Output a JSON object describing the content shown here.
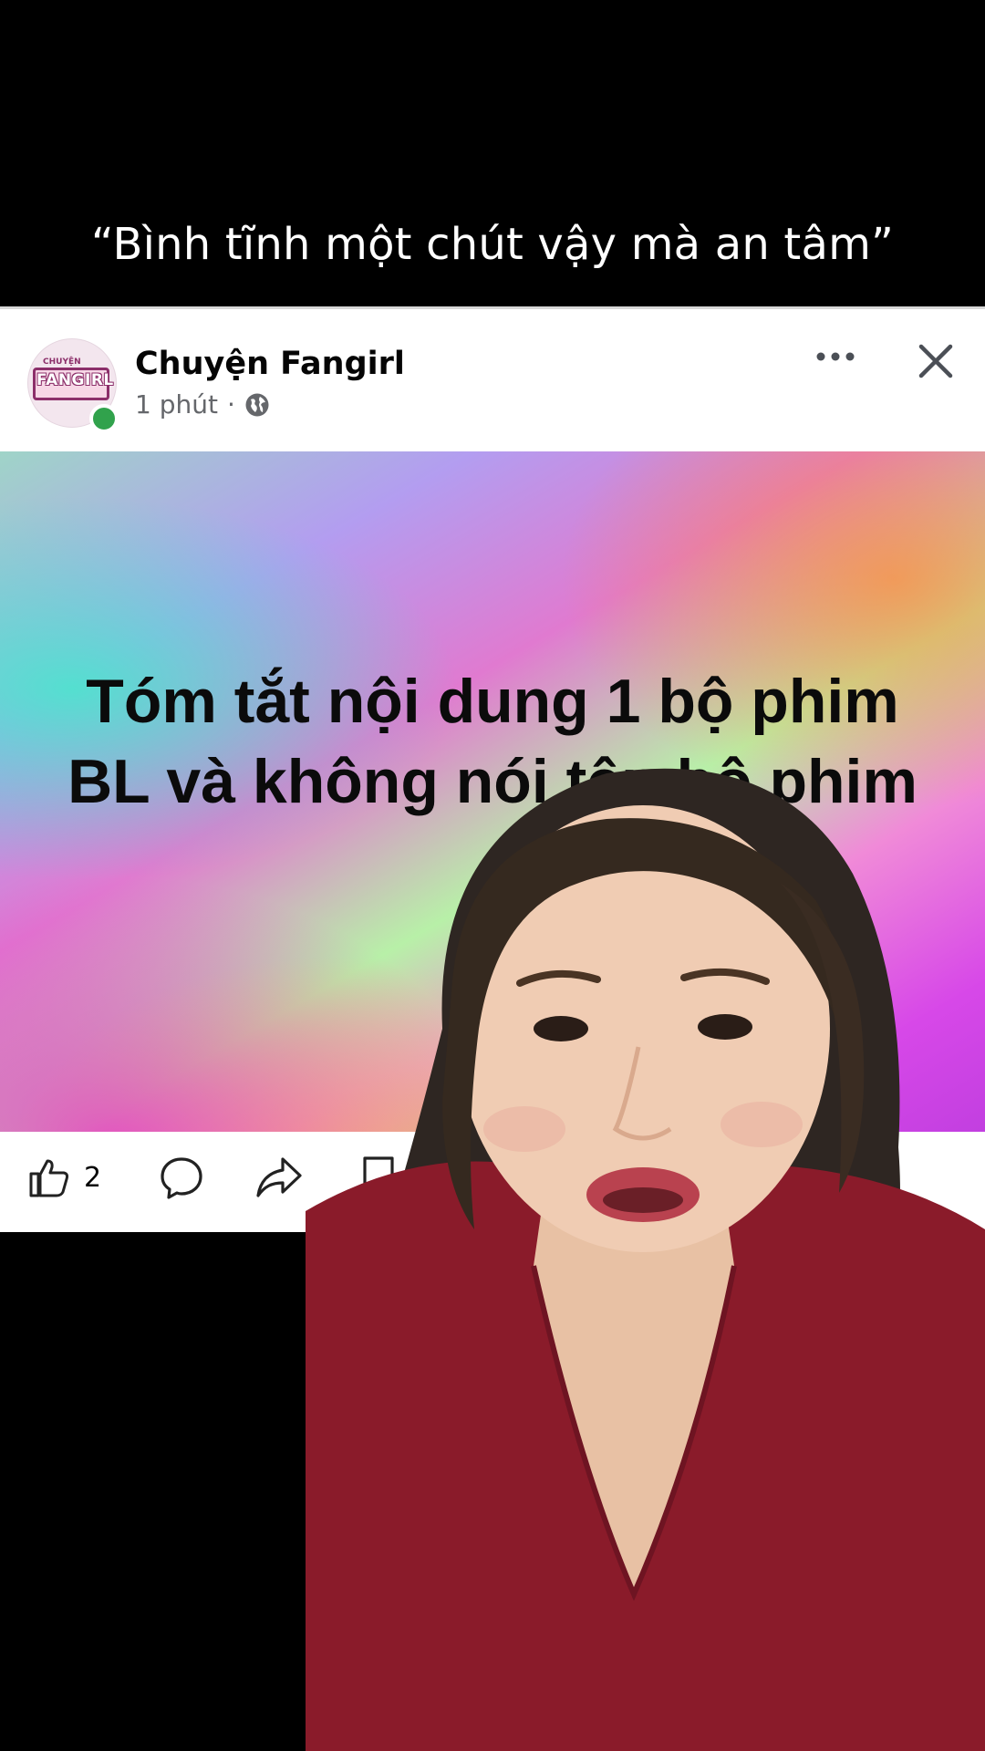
{
  "caption": "“Bình tĩnh một chút vậy mà an tâm”",
  "post": {
    "page_name": "Chuyện Fangirl",
    "time": "1 phút",
    "separator": "·",
    "avatar_logo_small": "CHUYỆN",
    "avatar_logo_text": "FANGIRL",
    "image_title": "Tóm tắt nội dung 1 bộ phim BL và không nói tên bộ phim",
    "like_count": "2"
  },
  "icons": {
    "globe": "globe-icon",
    "more": "more-horizontal-icon",
    "close": "close-icon",
    "like": "thumbs-up-icon",
    "comment": "comment-icon",
    "share": "share-icon",
    "save": "bookmark-icon"
  },
  "colors": {
    "background": "#000000",
    "card": "#ffffff",
    "name_text": "#050505",
    "meta_text": "#65676b",
    "online": "#31a24c"
  }
}
